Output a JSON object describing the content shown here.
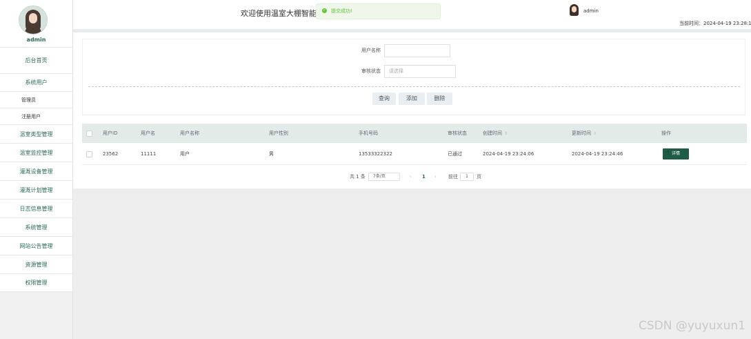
{
  "sidebar": {
    "profile_name": "admin",
    "items": [
      {
        "label": "后台首页"
      },
      {
        "label": "系统用户"
      },
      {
        "label": "管理员"
      },
      {
        "label": "注册用户"
      },
      {
        "label": "温室类型管理"
      },
      {
        "label": "温室监控管理"
      },
      {
        "label": "灌溉设备管理"
      },
      {
        "label": "灌溉计划管理"
      },
      {
        "label": "日志信息管理"
      },
      {
        "label": "系统管理"
      },
      {
        "label": "网站公告管理"
      },
      {
        "label": "资源管理"
      },
      {
        "label": "权限管理"
      }
    ]
  },
  "header": {
    "welcome": "欢迎使用温室大棚智能",
    "user_name": "admin",
    "time_label": "当前时间：",
    "time_value": "2024-04-19 23:28:1"
  },
  "toast": {
    "message": "提交成功!",
    "icon": "check-circle-icon",
    "color": "#67c23a"
  },
  "search": {
    "username_label": "用户名称",
    "username_value": "",
    "status_label": "审核状态",
    "status_placeholder": "请选择",
    "query_label": "查询",
    "add_label": "添加",
    "delete_label": "删除"
  },
  "table": {
    "headers": [
      "用户ID",
      "用户名",
      "用户名称",
      "用户性别",
      "手机号码",
      "审核状态",
      "创建时间",
      "更新时间",
      "操作"
    ],
    "rows": [
      {
        "id": "23562",
        "username": "11111",
        "name": "用户",
        "gender": "男",
        "phone": "13533322322",
        "status": "已通过",
        "created": "2024-04-19 23:24:06",
        "updated": "2024-04-19 23:24:46",
        "action": "详情"
      }
    ]
  },
  "pagination": {
    "total": "共 1 条",
    "page_size": "7条/页",
    "prev": "‹",
    "current": "1",
    "next": "›",
    "goto_label": "前往",
    "goto_value": "1",
    "page_unit": "页"
  },
  "watermark": "CSDN @yuyuxun1",
  "colors": {
    "accent": "#1e5c46",
    "sidebar_text": "#2b6b58",
    "table_header": "#e3ebe8"
  }
}
